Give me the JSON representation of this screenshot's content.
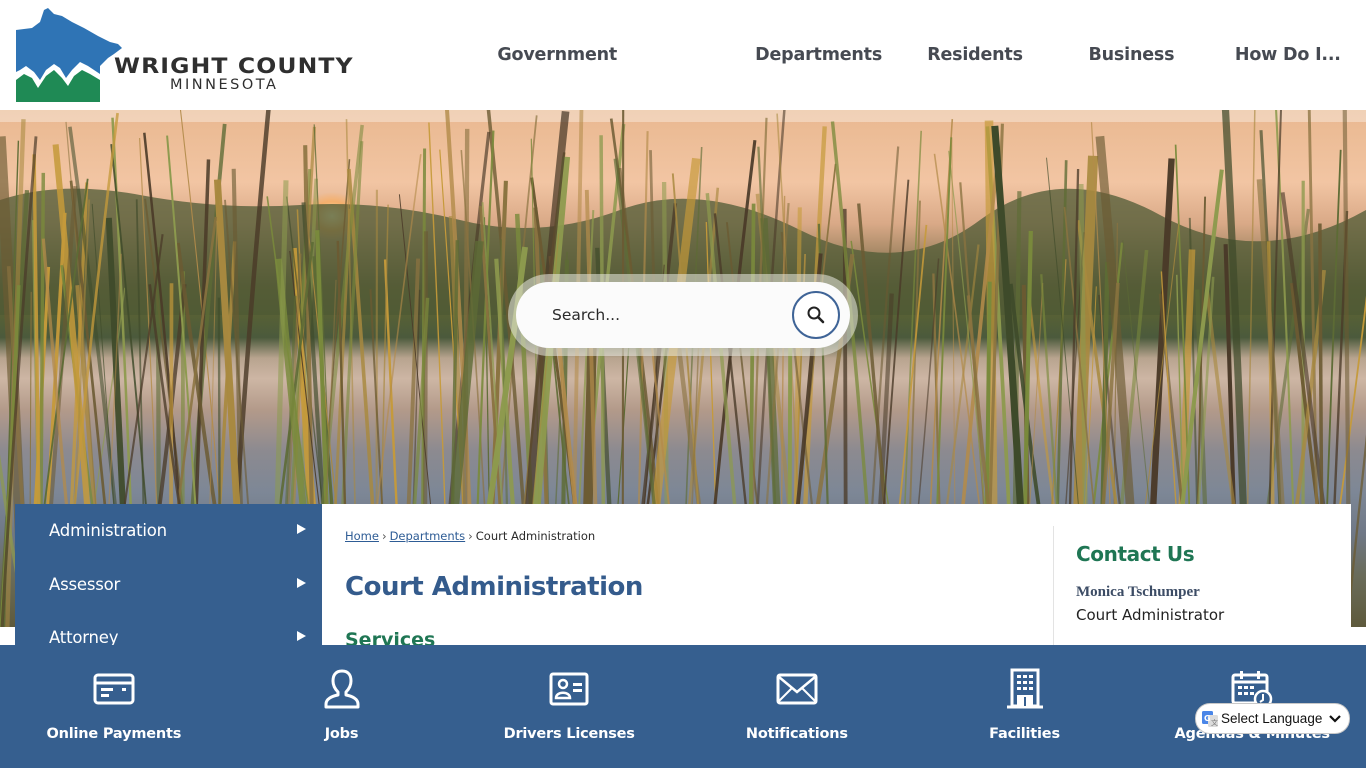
{
  "brand": {
    "name_line1": "WRIGHT COUNTY",
    "name_line2": "MINNESOTA",
    "colors": {
      "blue": "#2f74b5",
      "green": "#1f8a55",
      "nav_text": "#464a52"
    }
  },
  "main_nav": {
    "items": [
      {
        "label": "Government"
      },
      {
        "label": "Departments"
      },
      {
        "label": "Residents"
      },
      {
        "label": "Business"
      },
      {
        "label": "How Do I..."
      }
    ]
  },
  "search": {
    "placeholder": "Search...",
    "value": "",
    "button_icon": "search-icon"
  },
  "sidebar": {
    "items": [
      {
        "label": "Administration",
        "icon": "triangle-right-icon"
      },
      {
        "label": "Assessor",
        "icon": "triangle-right-icon"
      },
      {
        "label": "Attorney",
        "icon": "triangle-right-icon"
      }
    ],
    "background": "#365f8f"
  },
  "breadcrumb": {
    "items": [
      {
        "label": "Home",
        "link": true
      },
      {
        "label": "Departments",
        "link": true
      },
      {
        "label": "Court Administration",
        "link": false
      }
    ],
    "separator": "›"
  },
  "page": {
    "title": "Court Administration",
    "section_heading": "Services",
    "title_color": "#345b8c",
    "section_color": "#1f7654"
  },
  "contact": {
    "heading": "Contact Us",
    "name": "Monica Tschumper",
    "role": "Court Administrator"
  },
  "quick_links": {
    "items": [
      {
        "label": "Online Payments",
        "icon": "credit-card-icon"
      },
      {
        "label": "Jobs",
        "icon": "person-icon"
      },
      {
        "label": "Drivers Licenses",
        "icon": "id-card-icon"
      },
      {
        "label": "Notifications",
        "icon": "envelope-icon"
      },
      {
        "label": "Facilities",
        "icon": "building-icon"
      },
      {
        "label": "Agendas & Minutes",
        "icon": "calendar-clock-icon"
      }
    ],
    "background": "#365f8f"
  },
  "language_selector": {
    "selected": "Select Language",
    "icon": "google-translate-icon"
  }
}
